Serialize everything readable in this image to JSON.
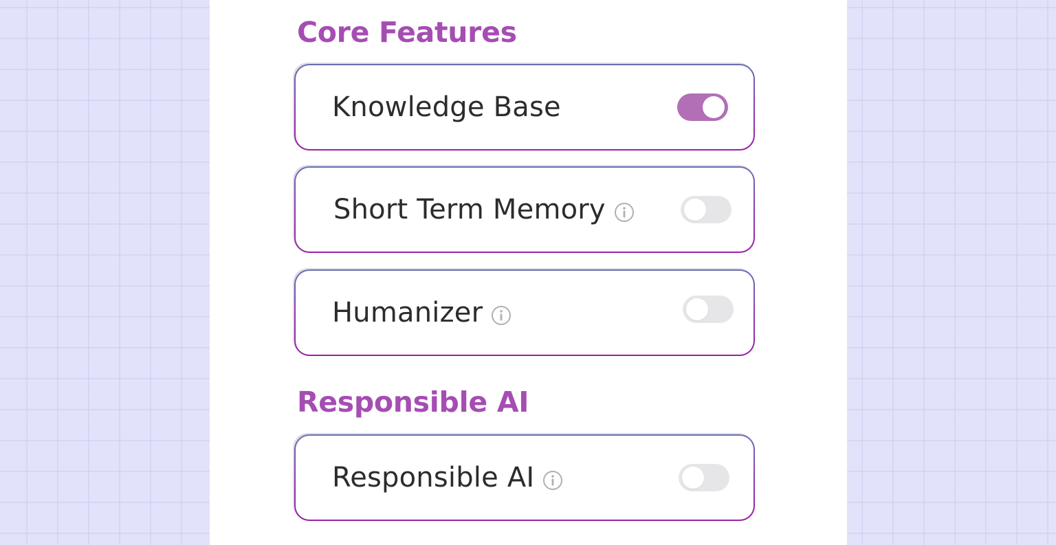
{
  "sections": [
    {
      "title": "Core Features",
      "features": [
        {
          "label": "Knowledge Base",
          "info": false,
          "enabled": true
        },
        {
          "label": "Short Term Memory",
          "info": true,
          "enabled": false
        },
        {
          "label": "Humanizer",
          "info": true,
          "enabled": false
        }
      ]
    },
    {
      "title": "Responsible AI",
      "features": [
        {
          "label": "Responsible AI",
          "info": true,
          "enabled": false
        }
      ]
    }
  ],
  "colors": {
    "accent": "#a54db3",
    "toggle_on": "#b36fb6",
    "toggle_off": "#e6e6e8",
    "background": "#e3e2fb"
  },
  "icons": {
    "info": "info-icon"
  }
}
